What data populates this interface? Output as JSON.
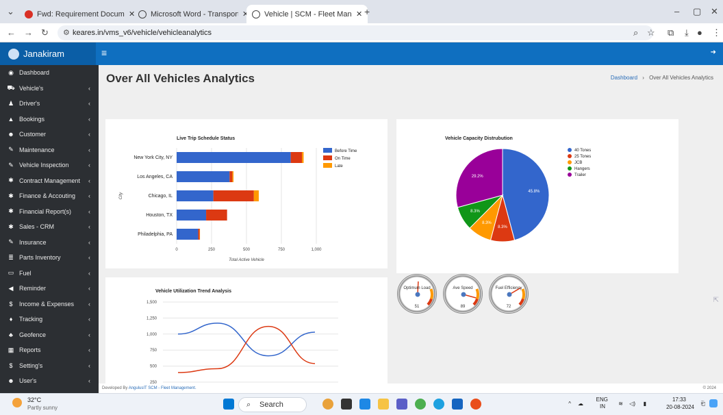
{
  "browser": {
    "tabs": [
      {
        "label": "Fwd: Requirement Document -",
        "color": "#d93025"
      },
      {
        "label": "Microsoft Word - Transport Or",
        "color": "#444"
      },
      {
        "label": "Vehicle | SCM - Fleet Managem",
        "color": "#444"
      }
    ],
    "url": "keares.in/vms_v6/vehicle/vehicleanalytics"
  },
  "app": {
    "brand": "Janakiram"
  },
  "sidebar": {
    "items": [
      {
        "label": "Dashboard",
        "icon": "dashboard-icon",
        "glyph": "◉",
        "chev": ""
      },
      {
        "label": "Vehicle's",
        "icon": "truck-icon",
        "glyph": "⛟",
        "chev": "‹"
      },
      {
        "label": "Driver's",
        "icon": "driver-icon",
        "glyph": "♟",
        "chev": "‹"
      },
      {
        "label": "Bookings",
        "icon": "bookings-icon",
        "glyph": "▲",
        "chev": "‹"
      },
      {
        "label": "Customer",
        "icon": "user-icon",
        "glyph": "☻",
        "chev": "‹"
      },
      {
        "label": "Maintenance",
        "icon": "wrench-icon",
        "glyph": "✎",
        "chev": "‹"
      },
      {
        "label": "Vehicle Inspection",
        "icon": "wrench-icon",
        "glyph": "✎",
        "chev": "‹"
      },
      {
        "label": "Contract Management",
        "icon": "cog-icon",
        "glyph": "✱",
        "chev": "‹"
      },
      {
        "label": "Finance & Accouting",
        "icon": "cog-icon",
        "glyph": "✱",
        "chev": "‹"
      },
      {
        "label": "Financial Report(s)",
        "icon": "cog-icon",
        "glyph": "✱",
        "chev": "‹"
      },
      {
        "label": "Sales - CRM",
        "icon": "cog-icon",
        "glyph": "✱",
        "chev": "‹"
      },
      {
        "label": "Insurance",
        "icon": "wrench-icon",
        "glyph": "✎",
        "chev": "‹"
      },
      {
        "label": "Parts Inventory",
        "icon": "parts-icon",
        "glyph": "≣",
        "chev": "‹"
      },
      {
        "label": "Fuel",
        "icon": "fuel-icon",
        "glyph": "▭",
        "chev": "‹"
      },
      {
        "label": "Reminder",
        "icon": "megaphone-icon",
        "glyph": "◀",
        "chev": "‹"
      },
      {
        "label": "Income & Expenses",
        "icon": "dollar-icon",
        "glyph": "$",
        "chev": "‹"
      },
      {
        "label": "Tracking",
        "icon": "pin-icon",
        "glyph": "♦",
        "chev": "‹"
      },
      {
        "label": "Geofence",
        "icon": "geofence-icon",
        "glyph": "♣",
        "chev": "‹"
      },
      {
        "label": "Reports",
        "icon": "reports-icon",
        "glyph": "▦",
        "chev": "‹"
      },
      {
        "label": "Setting's",
        "icon": "dollar-icon",
        "glyph": "$",
        "chev": "‹"
      },
      {
        "label": "User's",
        "icon": "user-icon",
        "glyph": "☻",
        "chev": "‹"
      }
    ]
  },
  "page": {
    "title": "Over All Vehicles Analytics",
    "crumb_home": "Dashboard",
    "crumb_sep": "›",
    "crumb_current": "Over All Vehicles Analytics"
  },
  "chart_data": [
    {
      "type": "bar",
      "orientation": "horizontal",
      "stacked": true,
      "title": "Live Trip Schedule Status",
      "xlabel": "Total Active Vehicle",
      "ylabel": "City",
      "xlim": [
        0,
        1000
      ],
      "xticks": [
        "0",
        "250",
        "500",
        "750",
        "1,000"
      ],
      "categories": [
        "New York City, NY",
        "Los Angeles, CA",
        "Chicago, IL",
        "Houston, TX",
        "Philadelphia, PA"
      ],
      "series": [
        {
          "name": "Before Time",
          "color": "#3366cc",
          "values": [
            817,
            379,
            263,
            211,
            154
          ]
        },
        {
          "name": "On Time",
          "color": "#dc3912",
          "values": [
            80,
            20,
            290,
            150,
            10
          ]
        },
        {
          "name": "Late",
          "color": "#ff9900",
          "values": [
            12,
            8,
            35,
            0,
            3
          ]
        }
      ],
      "legend": "right"
    },
    {
      "type": "pie",
      "title": "Vehicle Capacity Distrubution",
      "legend": "right",
      "slices": [
        {
          "label": "40 Tones",
          "value": 45.8,
          "text": "45.8%",
          "color": "#3366cc"
        },
        {
          "label": "25 Tones",
          "value": 8.3,
          "text": "8.3%",
          "color": "#dc3912"
        },
        {
          "label": "JCB",
          "value": 8.3,
          "text": "8.3%",
          "color": "#ff9900"
        },
        {
          "label": "Hangers",
          "value": 8.3,
          "text": "8.3%",
          "color": "#109618"
        },
        {
          "label": "Trailer",
          "value": 29.2,
          "text": "29.2%",
          "color": "#990099"
        }
      ]
    },
    {
      "type": "line",
      "title": "Vehicle Utilization Trend Analysis",
      "ylim": [
        250,
        1500
      ],
      "yticks": [
        "1,500",
        "1,250",
        "1,000",
        "750",
        "500",
        "250"
      ],
      "x": [
        0,
        1,
        2,
        3,
        4
      ],
      "series": [
        {
          "color": "#3366cc",
          "values": [
            1000,
            1170,
            660,
            1030,
            1030
          ]
        },
        {
          "color": "#dc3912",
          "values": [
            400,
            460,
            1120,
            540,
            540
          ]
        }
      ]
    },
    {
      "type": "gauge",
      "gauges": [
        {
          "label": "Optimum Load",
          "value": 51
        },
        {
          "label": "Ave Speed",
          "value": 89
        },
        {
          "label": "Fuel Efficiency",
          "value": 72
        }
      ]
    }
  ],
  "footer": {
    "dev_prefix": "Developed By ",
    "dev_link": "AngulusIT SCM - Fleet Management.",
    "year": "© 2024"
  },
  "taskbar": {
    "temp": "32°C",
    "weather": "Partly sunny",
    "search": "Search",
    "lang": "ENG",
    "region": "IN",
    "time": "17:33",
    "date": "20-08-2024"
  }
}
